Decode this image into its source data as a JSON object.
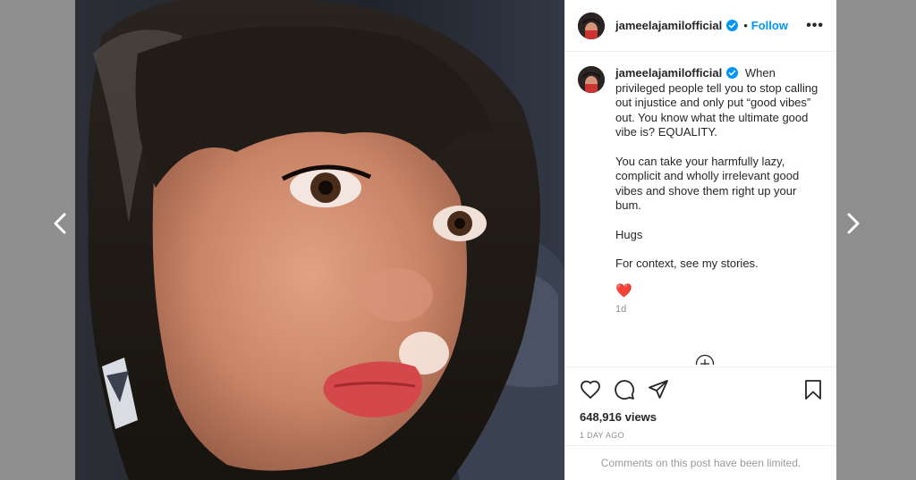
{
  "post": {
    "username": "jameelajamilofficial",
    "follow_label": "Follow",
    "separator": "•",
    "more_label": "•••",
    "caption": {
      "username": "jameelajamilofficial",
      "paragraphs": [
        "When privileged people tell you to stop calling out injustice and only put “good vibes” out. You know what the ultimate good vibe is? EQUALITY.",
        "You can take your harmfully lazy, complicit and wholly irrelevant good vibes and shove them right up your bum.",
        "Hugs",
        "For context, see my stories."
      ],
      "emoji": "❤️"
    },
    "caption_age": "1d",
    "views": "648,916 views",
    "posted_ago": "1 DAY AGO",
    "comments_notice": "Comments on this post have been limited."
  },
  "colors": {
    "accent": "#0095f6",
    "backdrop": "#8e8e8e"
  },
  "icons": [
    "chevron-left-icon",
    "chevron-right-icon",
    "verified-badge-icon",
    "more-icon",
    "heart-icon",
    "comment-icon",
    "share-icon",
    "bookmark-icon",
    "plus-circle-icon"
  ]
}
